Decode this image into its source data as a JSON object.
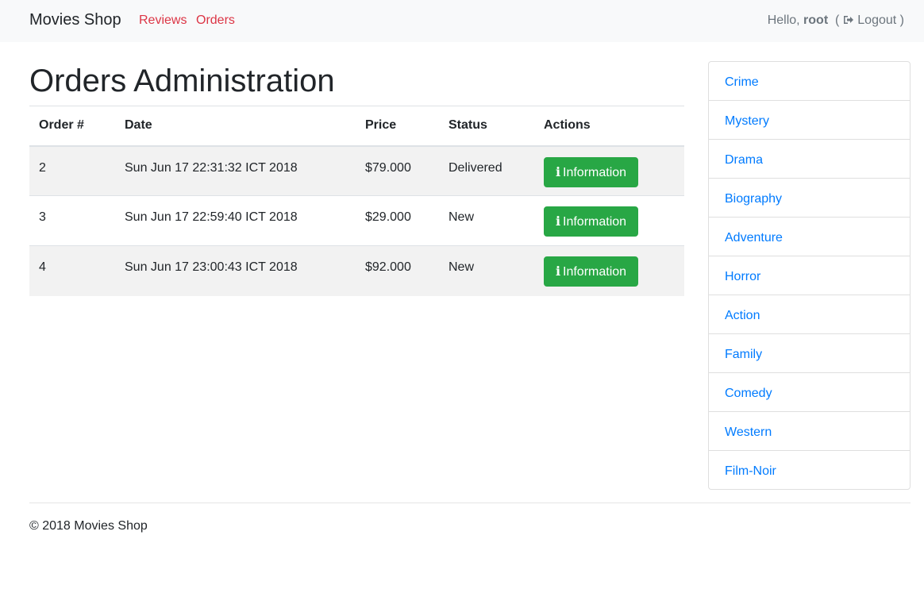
{
  "navbar": {
    "brand": "Movies Shop",
    "links": [
      "Reviews",
      "Orders"
    ],
    "greeting": "Hello,",
    "username": "root",
    "logout_open": "(",
    "logout_label": "Logout",
    "logout_close": ")",
    "logout_icon": "sign-out-icon"
  },
  "page": {
    "title": "Orders Administration"
  },
  "orders_table": {
    "headers": [
      "Order #",
      "Date",
      "Price",
      "Status",
      "Actions"
    ],
    "rows": [
      {
        "order": "2",
        "date": "Sun Jun 17 22:31:32 ICT 2018",
        "price": "$79.000",
        "status": "Delivered",
        "action": "Information"
      },
      {
        "order": "3",
        "date": "Sun Jun 17 22:59:40 ICT 2018",
        "price": "$29.000",
        "status": "New",
        "action": "Information"
      },
      {
        "order": "4",
        "date": "Sun Jun 17 23:00:43 ICT 2018",
        "price": "$92.000",
        "status": "New",
        "action": "Information"
      }
    ],
    "action_icon": "info-icon",
    "action_icon_glyph": "i"
  },
  "genres": [
    "Crime",
    "Mystery",
    "Drama",
    "Biography",
    "Adventure",
    "Horror",
    "Action",
    "Family",
    "Comedy",
    "Western",
    "Film-Noir"
  ],
  "footer": {
    "text": "© 2018 Movies Shop"
  },
  "colors": {
    "navbar_bg": "#f8f9fa",
    "nav_link": "#dc3545",
    "button_success": "#28a745",
    "genre_link": "#007bff",
    "row_stripe": "#f2f2f2"
  }
}
